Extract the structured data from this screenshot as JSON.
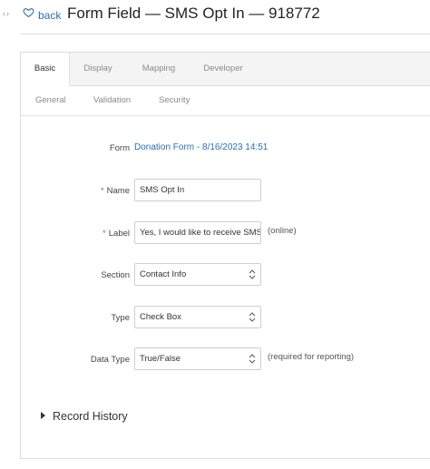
{
  "header": {
    "back_label": "back",
    "title": "Form Field — SMS Opt In — 918772",
    "collapse_icon": "‹›",
    "favorite_icon": "heart-outline"
  },
  "tabs": [
    {
      "label": "Basic",
      "active": true
    },
    {
      "label": "Display",
      "active": false
    },
    {
      "label": "Mapping",
      "active": false
    },
    {
      "label": "Developer",
      "active": false
    }
  ],
  "subtabs": [
    {
      "label": "General"
    },
    {
      "label": "Validation"
    },
    {
      "label": "Security"
    }
  ],
  "fields": {
    "form": {
      "label": "Form",
      "value": "Donation Form - 8/16/2023 14:51"
    },
    "name": {
      "label": "Name",
      "required": "*",
      "value": "SMS Opt In"
    },
    "field_label": {
      "label": "Label",
      "required": "*",
      "value": "Yes, I would like to receive SMS",
      "hint": "(online)"
    },
    "section": {
      "label": "Section",
      "value": "Contact Info"
    },
    "type": {
      "label": "Type",
      "value": "Check Box"
    },
    "data_type": {
      "label": "Data Type",
      "value": "True/False",
      "hint": "(required for reporting)"
    }
  },
  "record_history": {
    "label": "Record History"
  },
  "colors": {
    "link": "#2a6fb0",
    "required": "#d9534f",
    "border": "#dcdcdc"
  }
}
